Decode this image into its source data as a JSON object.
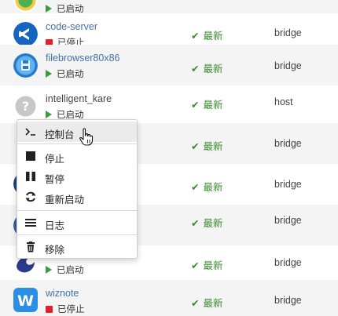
{
  "rows": [
    {
      "name": "",
      "status": "已启动",
      "state": "running",
      "update": "",
      "network": "",
      "name_style": "link"
    },
    {
      "name": "code-server",
      "status": "已停止",
      "state": "stopped",
      "update": "最新",
      "network": "bridge",
      "name_style": "link"
    },
    {
      "name": "filebrowser80x86",
      "status": "已启动",
      "state": "running",
      "update": "最新",
      "network": "bridge",
      "name_style": "link"
    },
    {
      "name": "intelligent_kare",
      "status": "已启动",
      "state": "running",
      "update": "最新",
      "network": "host",
      "name_style": "plain"
    },
    {
      "name": "",
      "status": "",
      "state": "",
      "update": "最新",
      "network": "bridge",
      "name_style": "link"
    },
    {
      "name": "",
      "status": "",
      "state": "",
      "update": "最新",
      "network": "bridge",
      "name_style": "link"
    },
    {
      "name": "",
      "status": "",
      "state": "",
      "update": "最新",
      "network": "bridge",
      "name_style": "link"
    },
    {
      "name": "",
      "status": "已启动",
      "state": "running",
      "update": "最新",
      "network": "bridge",
      "name_style": "link"
    },
    {
      "name": "wiznote",
      "status": "已停止",
      "state": "stopped",
      "update": "最新",
      "network": "bridge",
      "name_style": "link"
    }
  ],
  "context_menu": {
    "items": [
      {
        "label": "控制台",
        "icon": "terminal-icon"
      },
      {
        "label": "停止",
        "icon": "stop-icon"
      },
      {
        "label": "暂停",
        "icon": "pause-icon"
      },
      {
        "label": "重新启动",
        "icon": "restart-icon"
      },
      {
        "label": "日志",
        "icon": "log-lines-icon"
      },
      {
        "label": "移除",
        "icon": "trash-icon"
      }
    ],
    "hovered_item": "控制台"
  },
  "colors": {
    "link": "#4472a8",
    "update_green": "#3b8a2f",
    "running_green": "#3d9a3d",
    "stopped_red": "#e0202a",
    "row_alt": "#f4f4f4"
  }
}
